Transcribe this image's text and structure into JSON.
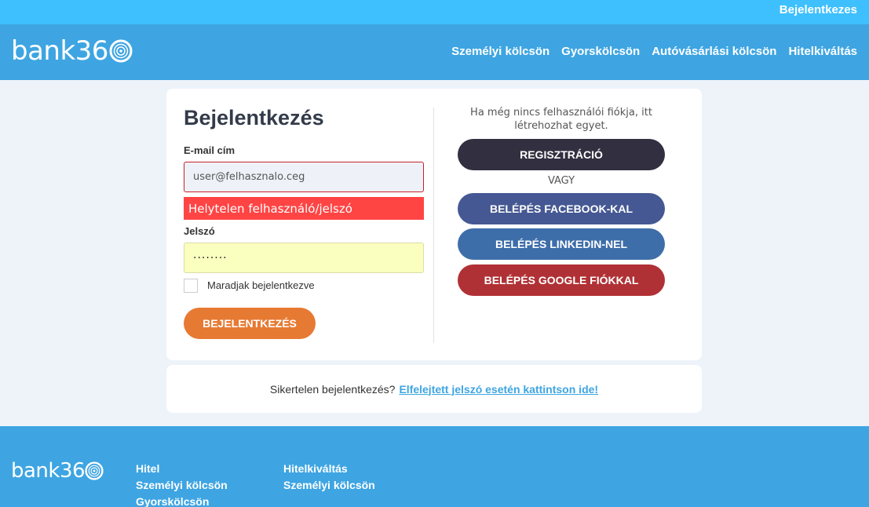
{
  "topbar": {
    "login_link": "Bejelentkezes"
  },
  "header": {
    "logo_text": "bank36",
    "nav": [
      {
        "label": "Személyi kölcsön"
      },
      {
        "label": "Gyorskölcsön"
      },
      {
        "label": "Autóvásárlási kölcsön"
      },
      {
        "label": "Hitelkiváltás"
      }
    ]
  },
  "login": {
    "title": "Bejelentkezés",
    "email_label": "E-mail cím",
    "email_placeholder": "user@felhasznalo.ceg",
    "error_message": "Helytelen felhasználó/jelszó",
    "password_label": "Jelszó",
    "password_value": "········",
    "remember_label": "Maradjak bejelentkezve",
    "submit_label": "BEJELENTKEZÉS"
  },
  "register": {
    "text": "Ha még nincs felhasználói fiókja, itt létrehozhat egyet.",
    "register_label": "REGISZTRÁCIÓ",
    "or_label": "VAGY",
    "facebook_label": "BELÉPÉS FACEBOOK-KAL",
    "linkedin_label": "BELÉPÉS LINKEDIN-NEL",
    "google_label": "BELÉPÉS GOOGLE FIÓKKAL"
  },
  "forgot": {
    "text": "Sikertelen bejelentkezés?",
    "link": "Elfelejtett jelszó esetén kattintson ide!"
  },
  "footer": {
    "logo_text": "bank36",
    "col1": {
      "heading": "Hitel",
      "items": [
        "Személyi kölcsön",
        "Gyorskölcsön"
      ]
    },
    "col2": {
      "heading": "Hitelkiváltás",
      "items": [
        "Személyi kölcsön"
      ]
    }
  },
  "colors": {
    "topbar": "#3ec0ff",
    "header": "#3ea5e2",
    "login_button": "#e77a33",
    "register_button": "#323040",
    "facebook_button": "#455893",
    "linkedin_button": "#3e6ea9",
    "google_button": "#b03135",
    "error": "#ff4444"
  }
}
